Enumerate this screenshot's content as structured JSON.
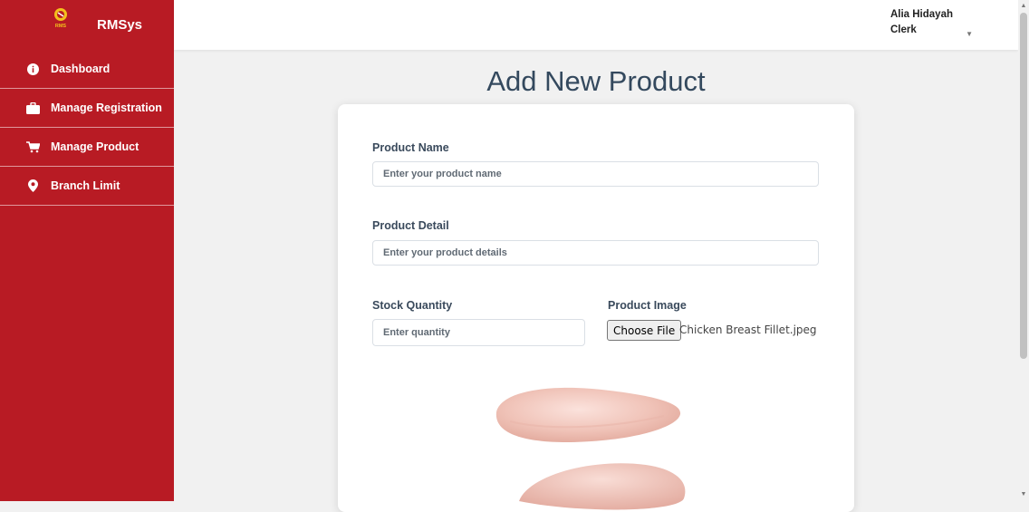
{
  "brand": {
    "name": "RMSys",
    "logo_text": "RMS"
  },
  "sidebar": {
    "items": [
      {
        "label": "Dashboard",
        "icon": "info-circle-icon"
      },
      {
        "label": "Manage Registration",
        "icon": "briefcase-icon"
      },
      {
        "label": "Manage Product",
        "icon": "cart-icon"
      },
      {
        "label": "Branch Limit",
        "icon": "map-pin-icon"
      }
    ]
  },
  "header": {
    "user_name": "Alia Hidayah",
    "user_role": "Clerk"
  },
  "page": {
    "title": "Add New Product"
  },
  "form": {
    "product_name": {
      "label": "Product Name",
      "placeholder": "Enter your product name"
    },
    "product_detail": {
      "label": "Product Detail",
      "placeholder": "Enter your product details"
    },
    "stock_quantity": {
      "label": "Stock Quantity",
      "placeholder": "Enter quantity"
    },
    "product_image": {
      "label": "Product Image",
      "button": "Choose File",
      "file_name": "Chicken Breast Fillet.jpeg"
    }
  },
  "colors": {
    "sidebar": "#b81b24",
    "title": "#34495e"
  }
}
